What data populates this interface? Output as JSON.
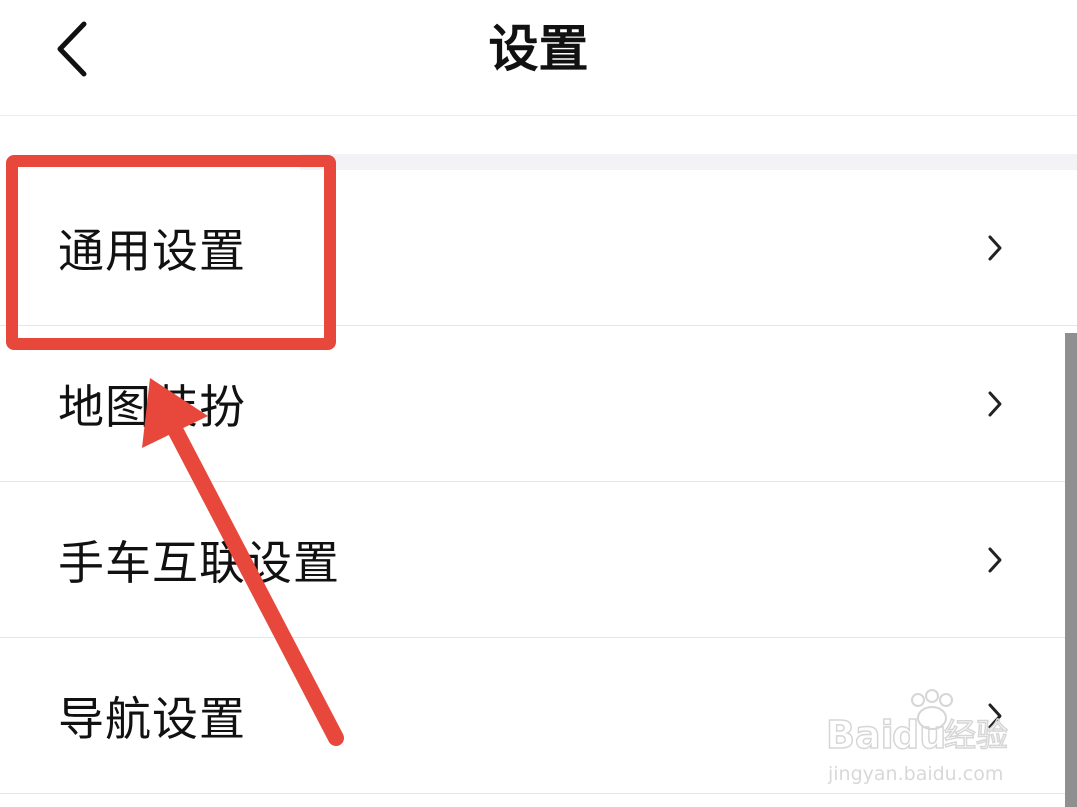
{
  "header": {
    "title": "设置",
    "back_icon": "chevron-left-icon"
  },
  "settings_list": {
    "items": [
      {
        "label": "通用设置",
        "icon": "chevron-right-icon"
      },
      {
        "label": "地图装扮",
        "icon": "chevron-right-icon"
      },
      {
        "label": "手车互联设置",
        "icon": "chevron-right-icon"
      },
      {
        "label": "导航设置",
        "icon": "chevron-right-icon"
      }
    ]
  },
  "annotation": {
    "highlight_color": "#e8473b",
    "highlighted_item": "通用设置"
  },
  "watermark": {
    "brand": "Baidu经验",
    "url": "jingyan.baidu.com"
  },
  "colors": {
    "title_text": "#111111",
    "divider": "#e6e6e6",
    "background": "#ffffff"
  }
}
